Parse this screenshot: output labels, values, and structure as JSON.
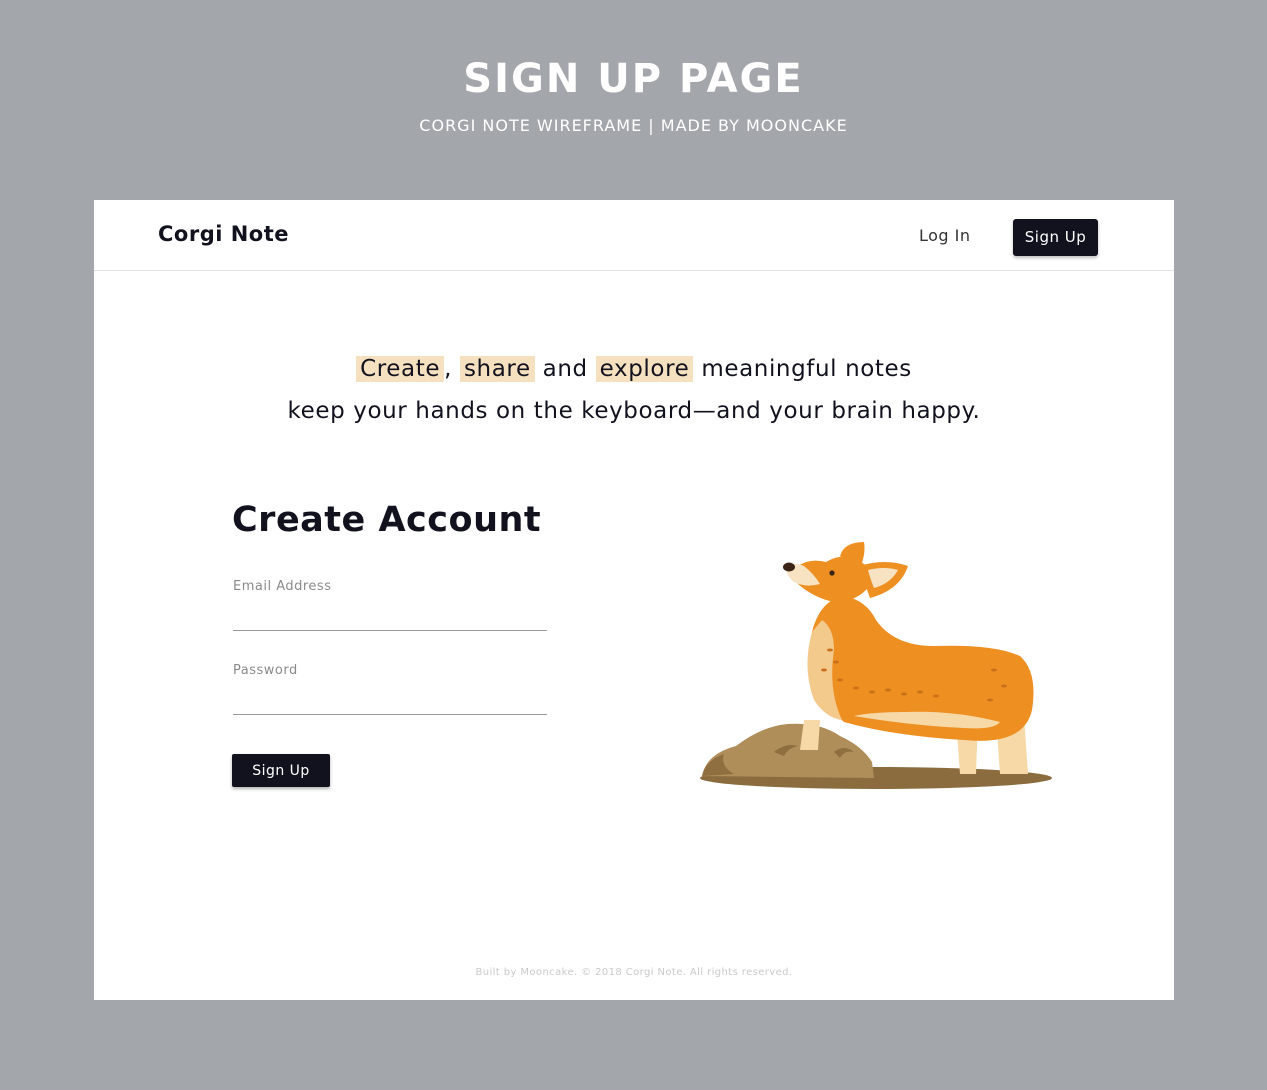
{
  "header": {
    "title": "SIGN UP PAGE",
    "subtitle": "CORGI NOTE WIREFRAME | MADE BY MOONCAKE"
  },
  "navbar": {
    "brand": "Corgi Note",
    "login_label": "Log In",
    "signup_label": "Sign Up"
  },
  "tagline": {
    "word1": "Create",
    "sep1": ",",
    "word2": "share",
    "sep2": "and",
    "word3": "explore",
    "rest": "meaningful notes",
    "line2": "keep your hands on the keyboard—and your brain happy."
  },
  "form": {
    "title": "Create Account",
    "email_label": "Email Address",
    "email_value": "",
    "password_label": "Password",
    "password_value": "",
    "submit_label": "Sign Up"
  },
  "illustration": {
    "icon": "corgi-illustration"
  },
  "footer": {
    "text": "Built by Mooncake. © 2018 Corgi Note. All rights reserved."
  },
  "colors": {
    "background": "#a3a6ab",
    "primary": "#12121f",
    "highlight": "#f5e1bf",
    "corgi_orange": "#ee8f22"
  }
}
